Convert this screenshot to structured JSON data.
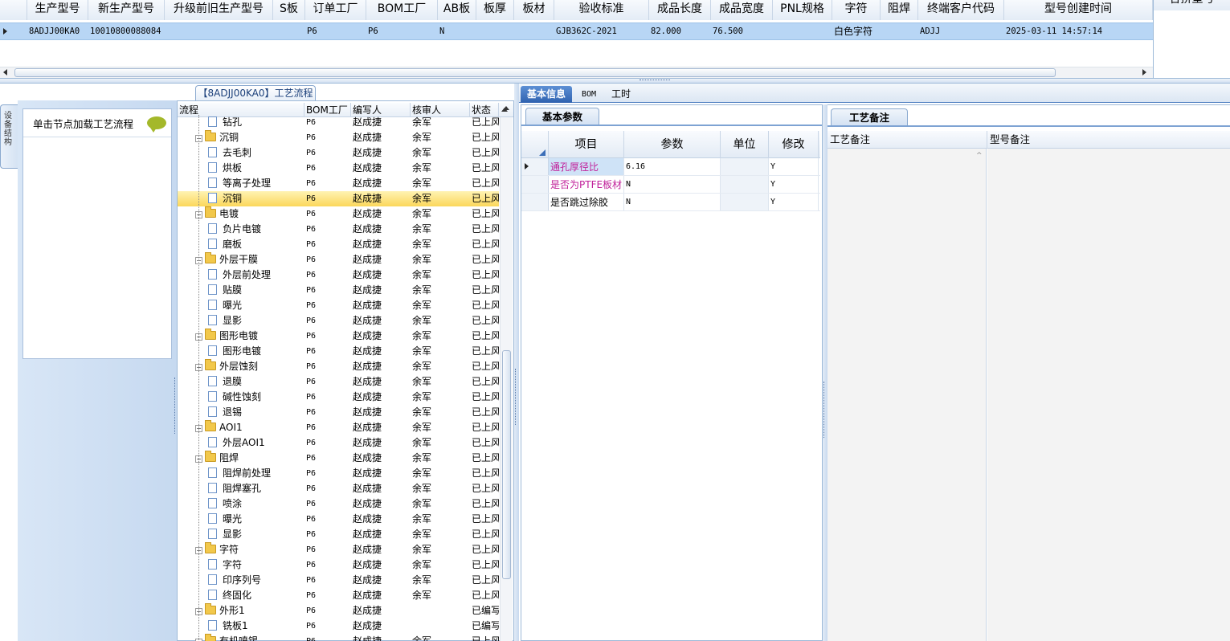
{
  "top_grid": {
    "columns": [
      "生产型号",
      "新生产型号",
      "升级前旧生产型号",
      "S板",
      "订单工厂",
      "BOM工厂",
      "AB板",
      "板厚",
      "板材",
      "验收标准",
      "成品长度",
      "成品宽度",
      "PNL规格",
      "字符",
      "阻焊",
      "终端客户代码",
      "型号创建时间"
    ],
    "row": [
      "8ADJJ00KA0",
      "10010800088084",
      "",
      "",
      "P6",
      "P6",
      "N",
      "",
      "",
      "GJB362C-2021",
      "82.000",
      "76.500",
      "",
      "白色字符",
      "",
      "ADJJ",
      "2025-03-11 14:57:14"
    ],
    "right_header": "合拼型号"
  },
  "left_panel": {
    "vertical_tab": "设备结构",
    "hint": "单击节点加载工艺流程"
  },
  "tree": {
    "title": "【8ADJJ00KA0】工艺流程",
    "headers": [
      "流程",
      "BOM工厂",
      "编写人",
      "核审人",
      "状态"
    ],
    "rows": [
      {
        "name": "钻孔",
        "level": 1,
        "factory": "P6",
        "writer": "赵成捷",
        "reviewer": "余军",
        "status": "已上风"
      },
      {
        "name": "沉铜",
        "level": 0,
        "factory": "P6",
        "writer": "赵成捷",
        "reviewer": "余军",
        "status": "已上风"
      },
      {
        "name": "去毛刺",
        "level": 1,
        "factory": "P6",
        "writer": "赵成捷",
        "reviewer": "余军",
        "status": "已上风"
      },
      {
        "name": "烘板",
        "level": 1,
        "factory": "P6",
        "writer": "赵成捷",
        "reviewer": "余军",
        "status": "已上风"
      },
      {
        "name": "等离子处理",
        "level": 1,
        "factory": "P6",
        "writer": "赵成捷",
        "reviewer": "余军",
        "status": "已上风"
      },
      {
        "name": "沉铜",
        "level": 1,
        "factory": "P6",
        "writer": "赵成捷",
        "reviewer": "余军",
        "status": "已上风",
        "selected": true
      },
      {
        "name": "电镀",
        "level": 0,
        "factory": "P6",
        "writer": "赵成捷",
        "reviewer": "余军",
        "status": "已上风"
      },
      {
        "name": "负片电镀",
        "level": 1,
        "factory": "P6",
        "writer": "赵成捷",
        "reviewer": "余军",
        "status": "已上风"
      },
      {
        "name": "磨板",
        "level": 1,
        "factory": "P6",
        "writer": "赵成捷",
        "reviewer": "余军",
        "status": "已上风"
      },
      {
        "name": "外层干膜",
        "level": 0,
        "factory": "P6",
        "writer": "赵成捷",
        "reviewer": "余军",
        "status": "已上风"
      },
      {
        "name": "外层前处理",
        "level": 1,
        "factory": "P6",
        "writer": "赵成捷",
        "reviewer": "余军",
        "status": "已上风"
      },
      {
        "name": "贴膜",
        "level": 1,
        "factory": "P6",
        "writer": "赵成捷",
        "reviewer": "余军",
        "status": "已上风"
      },
      {
        "name": "曝光",
        "level": 1,
        "factory": "P6",
        "writer": "赵成捷",
        "reviewer": "余军",
        "status": "已上风"
      },
      {
        "name": "显影",
        "level": 1,
        "factory": "P6",
        "writer": "赵成捷",
        "reviewer": "余军",
        "status": "已上风"
      },
      {
        "name": "图形电镀",
        "level": 0,
        "factory": "P6",
        "writer": "赵成捷",
        "reviewer": "余军",
        "status": "已上风"
      },
      {
        "name": "图形电镀",
        "level": 1,
        "factory": "P6",
        "writer": "赵成捷",
        "reviewer": "余军",
        "status": "已上风"
      },
      {
        "name": "外层蚀刻",
        "level": 0,
        "factory": "P6",
        "writer": "赵成捷",
        "reviewer": "余军",
        "status": "已上风"
      },
      {
        "name": "退膜",
        "level": 1,
        "factory": "P6",
        "writer": "赵成捷",
        "reviewer": "余军",
        "status": "已上风"
      },
      {
        "name": "碱性蚀刻",
        "level": 1,
        "factory": "P6",
        "writer": "赵成捷",
        "reviewer": "余军",
        "status": "已上风"
      },
      {
        "name": "退锡",
        "level": 1,
        "factory": "P6",
        "writer": "赵成捷",
        "reviewer": "余军",
        "status": "已上风"
      },
      {
        "name": "AOI1",
        "level": 0,
        "factory": "P6",
        "writer": "赵成捷",
        "reviewer": "余军",
        "status": "已上风"
      },
      {
        "name": "外层AOI1",
        "level": 1,
        "factory": "P6",
        "writer": "赵成捷",
        "reviewer": "余军",
        "status": "已上风"
      },
      {
        "name": "阻焊",
        "level": 0,
        "factory": "P6",
        "writer": "赵成捷",
        "reviewer": "余军",
        "status": "已上风"
      },
      {
        "name": "阻焊前处理",
        "level": 1,
        "factory": "P6",
        "writer": "赵成捷",
        "reviewer": "余军",
        "status": "已上风"
      },
      {
        "name": "阻焊塞孔",
        "level": 1,
        "factory": "P6",
        "writer": "赵成捷",
        "reviewer": "余军",
        "status": "已上风"
      },
      {
        "name": "喷涂",
        "level": 1,
        "factory": "P6",
        "writer": "赵成捷",
        "reviewer": "余军",
        "status": "已上风"
      },
      {
        "name": "曝光",
        "level": 1,
        "factory": "P6",
        "writer": "赵成捷",
        "reviewer": "余军",
        "status": "已上风"
      },
      {
        "name": "显影",
        "level": 1,
        "factory": "P6",
        "writer": "赵成捷",
        "reviewer": "余军",
        "status": "已上风"
      },
      {
        "name": "字符",
        "level": 0,
        "factory": "P6",
        "writer": "赵成捷",
        "reviewer": "余军",
        "status": "已上风"
      },
      {
        "name": "字符",
        "level": 1,
        "factory": "P6",
        "writer": "赵成捷",
        "reviewer": "余军",
        "status": "已上风"
      },
      {
        "name": "印序列号",
        "level": 1,
        "factory": "P6",
        "writer": "赵成捷",
        "reviewer": "余军",
        "status": "已上风"
      },
      {
        "name": "终固化",
        "level": 1,
        "factory": "P6",
        "writer": "赵成捷",
        "reviewer": "余军",
        "status": "已上风"
      },
      {
        "name": "外形1",
        "level": 0,
        "factory": "P6",
        "writer": "赵成捷",
        "reviewer": "",
        "status": "已编写"
      },
      {
        "name": "铣板1",
        "level": 1,
        "factory": "P6",
        "writer": "赵成捷",
        "reviewer": "",
        "status": "已编写"
      },
      {
        "name": "有机喷锡",
        "level": 0,
        "factory": "P6",
        "writer": "赵成捷",
        "reviewer": "余军",
        "status": "已上风"
      }
    ]
  },
  "tabs": [
    "基本信息",
    "BOM",
    "工时"
  ],
  "params": {
    "tab": "基本参数",
    "headers": [
      "项目",
      "参数",
      "单位",
      "修改"
    ],
    "rows": [
      {
        "item": "通孔厚径比",
        "value": "6.16",
        "unit": "",
        "modify": "Y"
      },
      {
        "item": "是否为PTFE板材",
        "value": "N",
        "unit": "",
        "modify": "Y"
      },
      {
        "item": "是否跳过除胶",
        "value": "N",
        "unit": "",
        "modify": "Y"
      }
    ]
  },
  "remarks": {
    "tab": "工艺备注",
    "headers": [
      "工艺备注",
      "型号备注"
    ]
  }
}
